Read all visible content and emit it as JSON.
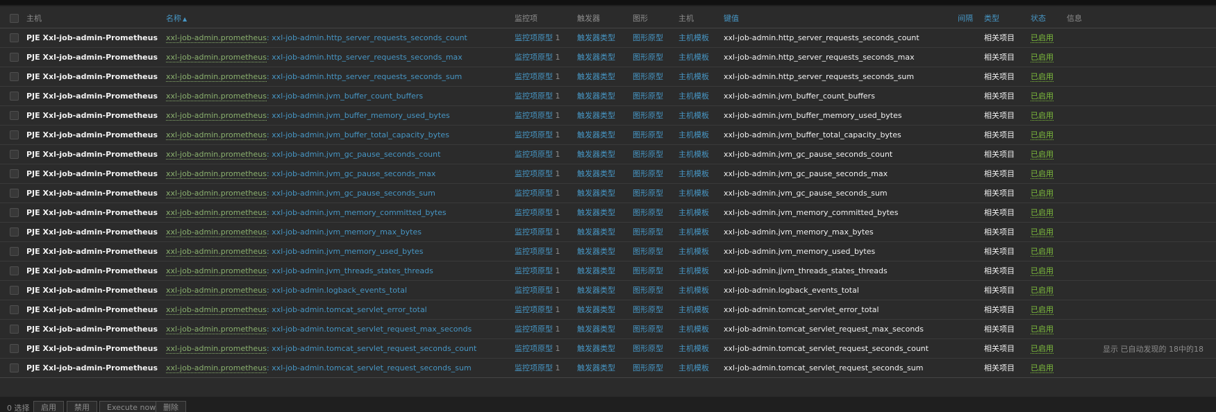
{
  "table": {
    "headers": {
      "host": "主机",
      "name": "名称",
      "name_sort_indicator": "▲",
      "items": "监控项",
      "triggers": "触发器",
      "graphs": "图形",
      "hosts": "主机",
      "key": "键值",
      "interval": "间隔",
      "type": "类型",
      "status": "状态",
      "info": "信息"
    },
    "rows": [
      {
        "host": "PJE Xxl-job-admin-Prometheus",
        "template": "xxl-job-admin.prometheus",
        "name": "xxl-job-admin.http_server_requests_seconds_count",
        "items": "监控项原型",
        "items_count": "1",
        "triggers": "触发器类型",
        "graphs": "图形原型",
        "hosts": "主机模板",
        "key": "xxl-job-admin.http_server_requests_seconds_count",
        "type": "相关项目",
        "status": "已启用"
      },
      {
        "host": "PJE Xxl-job-admin-Prometheus",
        "template": "xxl-job-admin.prometheus",
        "name": "xxl-job-admin.http_server_requests_seconds_max",
        "items": "监控项原型",
        "items_count": "1",
        "triggers": "触发器类型",
        "graphs": "图形原型",
        "hosts": "主机模板",
        "key": "xxl-job-admin.http_server_requests_seconds_max",
        "type": "相关项目",
        "status": "已启用"
      },
      {
        "host": "PJE Xxl-job-admin-Prometheus",
        "template": "xxl-job-admin.prometheus",
        "name": "xxl-job-admin.http_server_requests_seconds_sum",
        "items": "监控项原型",
        "items_count": "1",
        "triggers": "触发器类型",
        "graphs": "图形原型",
        "hosts": "主机模板",
        "key": "xxl-job-admin.http_server_requests_seconds_sum",
        "type": "相关项目",
        "status": "已启用"
      },
      {
        "host": "PJE Xxl-job-admin-Prometheus",
        "template": "xxl-job-admin.prometheus",
        "name": "xxl-job-admin.jvm_buffer_count_buffers",
        "items": "监控项原型",
        "items_count": "1",
        "triggers": "触发器类型",
        "graphs": "图形原型",
        "hosts": "主机模板",
        "key": "xxl-job-admin.jvm_buffer_count_buffers",
        "type": "相关项目",
        "status": "已启用"
      },
      {
        "host": "PJE Xxl-job-admin-Prometheus",
        "template": "xxl-job-admin.prometheus",
        "name": "xxl-job-admin.jvm_buffer_memory_used_bytes",
        "items": "监控项原型",
        "items_count": "1",
        "triggers": "触发器类型",
        "graphs": "图形原型",
        "hosts": "主机模板",
        "key": "xxl-job-admin.jvm_buffer_memory_used_bytes",
        "type": "相关项目",
        "status": "已启用"
      },
      {
        "host": "PJE Xxl-job-admin-Prometheus",
        "template": "xxl-job-admin.prometheus",
        "name": "xxl-job-admin.jvm_buffer_total_capacity_bytes",
        "items": "监控项原型",
        "items_count": "1",
        "triggers": "触发器类型",
        "graphs": "图形原型",
        "hosts": "主机模板",
        "key": "xxl-job-admin.jvm_buffer_total_capacity_bytes",
        "type": "相关项目",
        "status": "已启用"
      },
      {
        "host": "PJE Xxl-job-admin-Prometheus",
        "template": "xxl-job-admin.prometheus",
        "name": "xxl-job-admin.jvm_gc_pause_seconds_count",
        "items": "监控项原型",
        "items_count": "1",
        "triggers": "触发器类型",
        "graphs": "图形原型",
        "hosts": "主机模板",
        "key": "xxl-job-admin.jvm_gc_pause_seconds_count",
        "type": "相关项目",
        "status": "已启用"
      },
      {
        "host": "PJE Xxl-job-admin-Prometheus",
        "template": "xxl-job-admin.prometheus",
        "name": "xxl-job-admin.jvm_gc_pause_seconds_max",
        "items": "监控项原型",
        "items_count": "1",
        "triggers": "触发器类型",
        "graphs": "图形原型",
        "hosts": "主机模板",
        "key": "xxl-job-admin.jvm_gc_pause_seconds_max",
        "type": "相关项目",
        "status": "已启用"
      },
      {
        "host": "PJE Xxl-job-admin-Prometheus",
        "template": "xxl-job-admin.prometheus",
        "name": "xxl-job-admin.jvm_gc_pause_seconds_sum",
        "items": "监控项原型",
        "items_count": "1",
        "triggers": "触发器类型",
        "graphs": "图形原型",
        "hosts": "主机模板",
        "key": "xxl-job-admin.jvm_gc_pause_seconds_sum",
        "type": "相关项目",
        "status": "已启用"
      },
      {
        "host": "PJE Xxl-job-admin-Prometheus",
        "template": "xxl-job-admin.prometheus",
        "name": "xxl-job-admin.jvm_memory_committed_bytes",
        "items": "监控项原型",
        "items_count": "1",
        "triggers": "触发器类型",
        "graphs": "图形原型",
        "hosts": "主机模板",
        "key": "xxl-job-admin.jvm_memory_committed_bytes",
        "type": "相关项目",
        "status": "已启用"
      },
      {
        "host": "PJE Xxl-job-admin-Prometheus",
        "template": "xxl-job-admin.prometheus",
        "name": "xxl-job-admin.jvm_memory_max_bytes",
        "items": "监控项原型",
        "items_count": "1",
        "triggers": "触发器类型",
        "graphs": "图形原型",
        "hosts": "主机模板",
        "key": "xxl-job-admin.jvm_memory_max_bytes",
        "type": "相关项目",
        "status": "已启用"
      },
      {
        "host": "PJE Xxl-job-admin-Prometheus",
        "template": "xxl-job-admin.prometheus",
        "name": "xxl-job-admin.jvm_memory_used_bytes",
        "items": "监控项原型",
        "items_count": "1",
        "triggers": "触发器类型",
        "graphs": "图形原型",
        "hosts": "主机模板",
        "key": "xxl-job-admin.jvm_memory_used_bytes",
        "type": "相关项目",
        "status": "已启用"
      },
      {
        "host": "PJE Xxl-job-admin-Prometheus",
        "template": "xxl-job-admin.prometheus",
        "name": "xxl-job-admin.jvm_threads_states_threads",
        "items": "监控项原型",
        "items_count": "1",
        "triggers": "触发器类型",
        "graphs": "图形原型",
        "hosts": "主机模板",
        "key": "xxl-job-admin.jjvm_threads_states_threads",
        "type": "相关项目",
        "status": "已启用"
      },
      {
        "host": "PJE Xxl-job-admin-Prometheus",
        "template": "xxl-job-admin.prometheus",
        "name": "xxl-job-admin.logback_events_total",
        "items": "监控项原型",
        "items_count": "1",
        "triggers": "触发器类型",
        "graphs": "图形原型",
        "hosts": "主机模板",
        "key": "xxl-job-admin.logback_events_total",
        "type": "相关项目",
        "status": "已启用"
      },
      {
        "host": "PJE Xxl-job-admin-Prometheus",
        "template": "xxl-job-admin.prometheus",
        "name": "xxl-job-admin.tomcat_servlet_error_total",
        "items": "监控项原型",
        "items_count": "1",
        "triggers": "触发器类型",
        "graphs": "图形原型",
        "hosts": "主机模板",
        "key": "xxl-job-admin.tomcat_servlet_error_total",
        "type": "相关项目",
        "status": "已启用"
      },
      {
        "host": "PJE Xxl-job-admin-Prometheus",
        "template": "xxl-job-admin.prometheus",
        "name": "xxl-job-admin.tomcat_servlet_request_max_seconds",
        "items": "监控项原型",
        "items_count": "1",
        "triggers": "触发器类型",
        "graphs": "图形原型",
        "hosts": "主机模板",
        "key": "xxl-job-admin.tomcat_servlet_request_max_seconds",
        "type": "相关项目",
        "status": "已启用"
      },
      {
        "host": "PJE Xxl-job-admin-Prometheus",
        "template": "xxl-job-admin.prometheus",
        "name": "xxl-job-admin.tomcat_servlet_request_seconds_count",
        "items": "监控项原型",
        "items_count": "1",
        "triggers": "触发器类型",
        "graphs": "图形原型",
        "hosts": "主机模板",
        "key": "xxl-job-admin.tomcat_servlet_request_seconds_count",
        "type": "相关项目",
        "status": "已启用"
      },
      {
        "host": "PJE Xxl-job-admin-Prometheus",
        "template": "xxl-job-admin.prometheus",
        "name": "xxl-job-admin.tomcat_servlet_request_seconds_sum",
        "items": "监控项原型",
        "items_count": "1",
        "triggers": "触发器类型",
        "graphs": "图形原型",
        "hosts": "主机模板",
        "key": "xxl-job-admin.tomcat_servlet_request_seconds_sum",
        "type": "相关项目",
        "status": "已启用"
      }
    ],
    "summary": "显示 已自动发现的 18中的18"
  },
  "footer": {
    "selected_count": "0 选择",
    "buttons": [
      "启用",
      "禁用",
      "Execute now",
      "删除"
    ]
  },
  "colors": {
    "background": "#2b2b2b",
    "link": "#4796c4",
    "template_link": "#8ab06e",
    "status_enabled": "#7fbf3c",
    "muted_text": "#8d8d8d"
  },
  "icons": {
    "checkbox": "checkbox-icon",
    "sort": "sort-ascending-icon"
  }
}
